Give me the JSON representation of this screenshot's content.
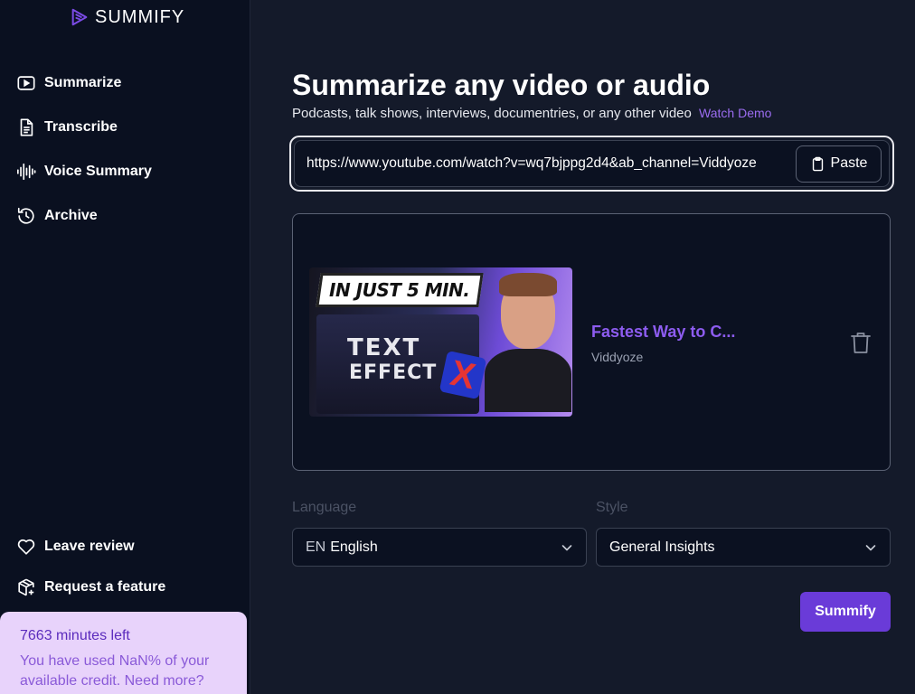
{
  "app": {
    "name": "SUMMIFY",
    "brand_color": "#7b4be6"
  },
  "sidebar": {
    "items": [
      {
        "label": "Summarize",
        "icon": "play-icon"
      },
      {
        "label": "Transcribe",
        "icon": "document-icon"
      },
      {
        "label": "Voice Summary",
        "icon": "waveform-icon"
      },
      {
        "label": "Archive",
        "icon": "history-icon"
      }
    ],
    "bottom_items": [
      {
        "label": "Leave review",
        "icon": "heart-icon"
      },
      {
        "label": "Request a feature",
        "icon": "package-plus-icon"
      }
    ],
    "credits": {
      "title": "7663 minutes left",
      "description": "You have used NaN% of your available credit. Need more?"
    }
  },
  "main": {
    "title": "Summarize any video or audio",
    "subtitle": "Podcasts, talk shows, interviews, documentries, or any other video",
    "watch_demo": "Watch Demo",
    "url_input": {
      "value": "https://www.youtube.com/watch?v=wq7bjppg2d4&ab_channel=Viddyoze"
    },
    "paste_label": "Paste",
    "video": {
      "title": "Fastest Way to C...",
      "channel": "Viddyoze",
      "thumbnail_banner": "IN JUST 5 MIN.",
      "thumbnail_text_1": "TEXT",
      "thumbnail_text_2": "EFFECT",
      "thumbnail_badge": "X"
    },
    "language": {
      "label": "Language",
      "code": "EN",
      "value": "English"
    },
    "style": {
      "label": "Style",
      "value": "General Insights"
    },
    "submit_label": "Summify"
  }
}
